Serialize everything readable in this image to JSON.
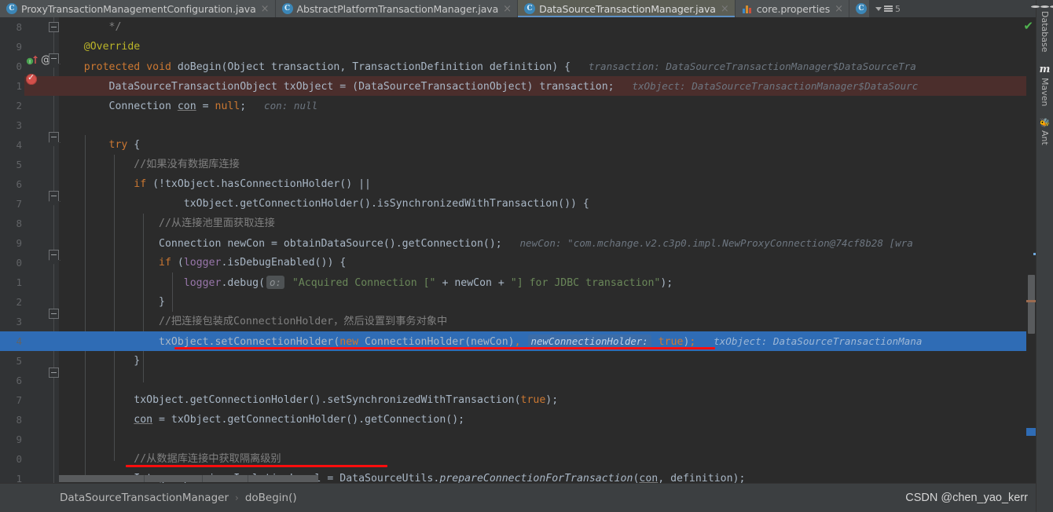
{
  "tabs": [
    {
      "label": "ProxyTransactionManagementConfiguration.java",
      "icon": "java-class-icon",
      "active": false,
      "close": "×"
    },
    {
      "label": "AbstractPlatformTransactionManager.java",
      "icon": "java-class-icon",
      "active": false,
      "close": "×"
    },
    {
      "label": "DataSourceTransactionManager.java",
      "icon": "java-class-icon",
      "active": true,
      "close": "×"
    },
    {
      "label": "core.properties",
      "icon": "properties-file-icon",
      "active": false,
      "close": "×"
    }
  ],
  "tab_overflow": {
    "count": "5",
    "icon": "chevron-down-icon"
  },
  "tool_windows": [
    {
      "label": "Database",
      "icon": "database-icon"
    },
    {
      "label": "Maven",
      "icon": "maven-icon"
    },
    {
      "label": "Ant",
      "icon": "ant-icon"
    }
  ],
  "inspection_status": {
    "icon": "checkmark-icon",
    "glyph": "✔",
    "color": "#4fb34f"
  },
  "gutter": {
    "overriding_method_icon": "overriding-method-icon",
    "annotation_icon": "at-sign-icon",
    "breakpoint_icon": "verified-breakpoint-icon",
    "at_glyph": "@"
  },
  "breadcrumb": {
    "class": "DataSourceTransactionManager",
    "separator": "›",
    "method": "doBegin()"
  },
  "watermark": "CSDN @chen_yao_kerr",
  "colors": {
    "editor_bg": "#2b2b2b",
    "gutter_bg": "#313335",
    "selection_bg": "#2f6cb5",
    "breakpoint_line_bg": "#4b2e2c",
    "keyword": "#cc7832",
    "string": "#6a8759",
    "comment": "#808080",
    "annotation": "#bbb529",
    "field": "#9876aa",
    "method": "#ffc66d",
    "default_text": "#a9b7c6",
    "inlay_hint": "#6d7680",
    "red_underline": "#ff0d0d",
    "accent_tab": "#5d8fc4"
  },
  "code_lines": [
    {
      "num": "8",
      "bg": "none",
      "fold": null,
      "segments": [
        {
          "t": "        ",
          "c": "id"
        },
        {
          "t": "*/",
          "c": "cmt"
        }
      ]
    },
    {
      "num": "9",
      "bg": "none",
      "fold": null,
      "segments": [
        {
          "t": "    ",
          "c": "id"
        },
        {
          "t": "@Override",
          "c": "ann"
        }
      ]
    },
    {
      "num": "0",
      "bg": "none",
      "fold": "start",
      "segments": [
        {
          "t": "    ",
          "c": "id"
        },
        {
          "t": "protected",
          "c": "kw"
        },
        {
          "t": " ",
          "c": "id"
        },
        {
          "t": "void",
          "c": "kw"
        },
        {
          "t": " ",
          "c": "id"
        },
        {
          "t": "doBegin",
          "c": "id"
        },
        {
          "t": "(Object transaction, TransactionDefinition definition) {",
          "c": "id"
        },
        {
          "t": "   transaction: DataSourceTransactionManager$DataSourceTra",
          "c": "hint"
        }
      ]
    },
    {
      "num": "1",
      "bg": "bp",
      "fold": null,
      "segments": [
        {
          "t": "        DataSourceTransactionObject txObject = (DataSourceTransactionObject) transaction;",
          "c": "id"
        },
        {
          "t": "   txObject: DataSourceTransactionManager$DataSourc",
          "c": "hint"
        }
      ]
    },
    {
      "num": "2",
      "bg": "none",
      "fold": null,
      "segments": [
        {
          "t": "        Connection ",
          "c": "id"
        },
        {
          "t": "con",
          "c": "under"
        },
        {
          "t": " = ",
          "c": "id"
        },
        {
          "t": "null",
          "c": "kw"
        },
        {
          "t": ";",
          "c": "id"
        },
        {
          "t": "   con: null",
          "c": "hint"
        }
      ]
    },
    {
      "num": "3",
      "bg": "none",
      "fold": null,
      "segments": []
    },
    {
      "num": "4",
      "bg": "none",
      "fold": "start",
      "segments": [
        {
          "t": "        ",
          "c": "id"
        },
        {
          "t": "try",
          "c": "kw"
        },
        {
          "t": " {",
          "c": "id"
        }
      ]
    },
    {
      "num": "5",
      "bg": "none",
      "fold": null,
      "segments": [
        {
          "t": "            //如果没有数据库连接",
          "c": "cmt"
        }
      ]
    },
    {
      "num": "6",
      "bg": "none",
      "fold": null,
      "segments": [
        {
          "t": "            ",
          "c": "id"
        },
        {
          "t": "if",
          "c": "kw"
        },
        {
          "t": " (!txObject.hasConnectionHolder() ||",
          "c": "id"
        }
      ]
    },
    {
      "num": "7",
      "bg": "none",
      "fold": "start",
      "segments": [
        {
          "t": "                    txObject.getConnectionHolder().isSynchronizedWithTransaction()) {",
          "c": "id"
        }
      ]
    },
    {
      "num": "8",
      "bg": "none",
      "fold": null,
      "segments": [
        {
          "t": "                //从连接池里面获取连接",
          "c": "cmt"
        }
      ]
    },
    {
      "num": "9",
      "bg": "none",
      "fold": null,
      "segments": [
        {
          "t": "                Connection newCon = obtainDataSource().getConnection();",
          "c": "id"
        },
        {
          "t": "   newCon: \"com.mchange.v2.c3p0.impl.NewProxyConnection@74cf8b28 [wra",
          "c": "hint"
        }
      ]
    },
    {
      "num": "0",
      "bg": "none",
      "fold": "start",
      "segments": [
        {
          "t": "                ",
          "c": "id"
        },
        {
          "t": "if",
          "c": "kw"
        },
        {
          "t": " (",
          "c": "id"
        },
        {
          "t": "logger",
          "c": "fld"
        },
        {
          "t": ".isDebugEnabled()) {",
          "c": "id"
        }
      ]
    },
    {
      "num": "1",
      "bg": "none",
      "fold": null,
      "segments": [
        {
          "t": "                    ",
          "c": "id"
        },
        {
          "t": "logger",
          "c": "fld"
        },
        {
          "t": ".debug(",
          "c": "id"
        },
        {
          "t": "o:",
          "c": "obadge"
        },
        {
          "t": " \"Acquired Connection [\"",
          "c": "str"
        },
        {
          "t": " + newCon + ",
          "c": "id"
        },
        {
          "t": "\"] for JDBC transaction\"",
          "c": "str"
        },
        {
          "t": ");",
          "c": "id"
        }
      ]
    },
    {
      "num": "2",
      "bg": "none",
      "fold": "end",
      "segments": [
        {
          "t": "                }",
          "c": "id"
        }
      ]
    },
    {
      "num": "3",
      "bg": "none",
      "fold": null,
      "segments": [
        {
          "t": "                //把连接包装成ConnectionHolder，然后设置到事务对象中",
          "c": "cmt"
        }
      ]
    },
    {
      "num": "4",
      "bg": "sel",
      "fold": null,
      "segments": [
        {
          "t": "                txObject.setConnectionHolder(",
          "c": "id"
        },
        {
          "t": "new",
          "c": "kw"
        },
        {
          "t": " ConnectionHolder(newCon)",
          "c": "id"
        },
        {
          "t": ",",
          "c": "kw"
        },
        {
          "t": " ",
          "c": "id"
        },
        {
          "t": "newConnectionHolder:",
          "c": "pbadge"
        },
        {
          "t": " ",
          "c": "id"
        },
        {
          "t": "true",
          "c": "kw"
        },
        {
          "t": ")",
          "c": "id"
        },
        {
          "t": ";",
          "c": "kw"
        },
        {
          "t": "   txObject: DataSourceTransactionMana",
          "c": "hint"
        }
      ]
    },
    {
      "num": "5",
      "bg": "none",
      "fold": "end",
      "segments": [
        {
          "t": "            }",
          "c": "id"
        }
      ]
    },
    {
      "num": "6",
      "bg": "none",
      "fold": null,
      "segments": []
    },
    {
      "num": "7",
      "bg": "none",
      "fold": null,
      "segments": [
        {
          "t": "            txObject.getConnectionHolder().setSynchronizedWithTransaction(",
          "c": "id"
        },
        {
          "t": "true",
          "c": "kw"
        },
        {
          "t": ");",
          "c": "id"
        }
      ]
    },
    {
      "num": "8",
      "bg": "none",
      "fold": null,
      "segments": [
        {
          "t": "            ",
          "c": "id"
        },
        {
          "t": "con",
          "c": "under"
        },
        {
          "t": " = txObject.getConnectionHolder().getConnection();",
          "c": "id"
        }
      ]
    },
    {
      "num": "9",
      "bg": "none",
      "fold": null,
      "segments": []
    },
    {
      "num": "0",
      "bg": "none",
      "fold": null,
      "segments": [
        {
          "t": "            //从数据库连接中获取隔离级别",
          "c": "cmt"
        }
      ]
    },
    {
      "num": "1",
      "bg": "none",
      "fold": null,
      "segments": [
        {
          "t": "            Integer previousIsolationLevel = DataSourceUtils.",
          "c": "id"
        },
        {
          "t": "prepareConnectionForTransaction",
          "c": "stat"
        },
        {
          "t": "(",
          "c": "id"
        },
        {
          "t": "con",
          "c": "under"
        },
        {
          "t": ", definition);",
          "c": "id"
        }
      ]
    }
  ]
}
